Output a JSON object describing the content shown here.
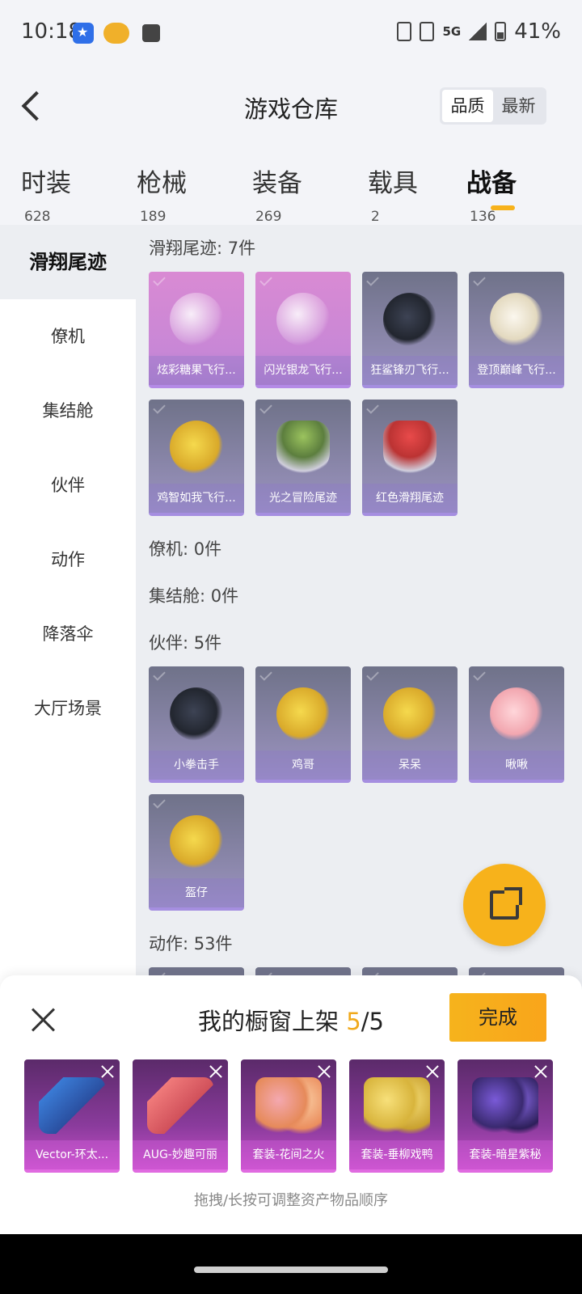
{
  "status_bar": {
    "time": "10:18",
    "network": "5G",
    "battery": "41%"
  },
  "header": {
    "title": "游戏仓库",
    "sort": [
      "品质",
      "最新"
    ]
  },
  "tabs": [
    {
      "label": "时装",
      "count": "628"
    },
    {
      "label": "枪械",
      "count": "189"
    },
    {
      "label": "装备",
      "count": "269"
    },
    {
      "label": "载具",
      "count": "2"
    },
    {
      "label": "战备",
      "count": "136"
    }
  ],
  "sidebar": [
    "滑翔尾迹",
    "僚机",
    "集结舱",
    "伙伴",
    "动作",
    "降落伞",
    "大厅场景"
  ],
  "sections": {
    "glide": {
      "title": "滑翔尾迹: 7件",
      "items": [
        "炫彩糖果飞行...",
        "闪光银龙飞行...",
        "狂鲨锋刃飞行...",
        "登顶巅峰飞行...",
        "鸡智如我飞行...",
        "光之冒险尾迹",
        "红色滑翔尾迹"
      ]
    },
    "wingman": {
      "title": "僚机: 0件"
    },
    "pod": {
      "title": "集结舱: 0件"
    },
    "partner": {
      "title": "伙伴: 5件",
      "items": [
        "小拳击手",
        "鸡哥",
        "呆呆",
        "啾啾",
        "盔仔"
      ]
    },
    "action": {
      "title": "动作: 53件"
    }
  },
  "sheet": {
    "title_prefix": "我的橱窗上架",
    "count_current": "5",
    "count_total": "/5",
    "done_label": "完成",
    "items": [
      "Vector-环太...",
      "AUG-妙趣可丽",
      "套装-花间之火",
      "套装-垂柳戏鸭",
      "套装-暗星紫秘"
    ],
    "hint": "拖拽/长按可调整资产物品顺序"
  },
  "colors": {
    "accent": "#f7b21b",
    "legendary": "#c887d6",
    "epic": "#9c91c7"
  }
}
